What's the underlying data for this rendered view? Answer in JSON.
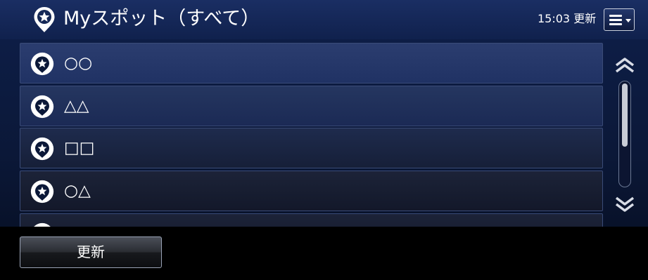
{
  "header": {
    "icon": "spot-pin-star-icon",
    "title": "Myスポット（すべて）",
    "update_time": "15:03 更新",
    "menu_icon": "menu-list-icon"
  },
  "spots": [
    {
      "label": "○○",
      "icon": "spot-pin-star-icon"
    },
    {
      "label": "△△",
      "icon": "spot-pin-star-icon"
    },
    {
      "label": "□□",
      "icon": "spot-pin-star-icon"
    },
    {
      "label": "○△",
      "icon": "spot-pin-star-icon"
    }
  ],
  "scrollbar": {
    "up_icon": "double-chevron-up-icon",
    "down_icon": "double-chevron-down-icon"
  },
  "footer": {
    "refresh_label": "更新"
  },
  "colors": {
    "background": "#0b1838",
    "header": "#1a2e63",
    "footer": "#000000",
    "text": "#ffffff"
  }
}
